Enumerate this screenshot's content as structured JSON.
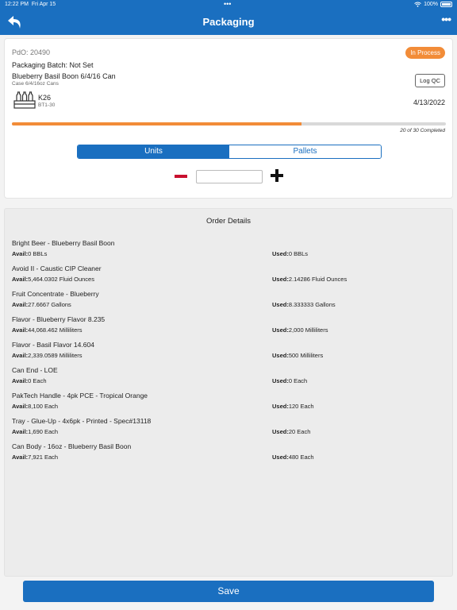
{
  "status_bar": {
    "time": "12:22 PM",
    "date": "Fri Apr 15",
    "battery": "100%",
    "center_dots": "•••"
  },
  "nav": {
    "title": "Packaging",
    "more": "•••"
  },
  "card": {
    "pdo": "PdO: 20490",
    "status": "In Process",
    "batch": "Packaging Batch: Not Set",
    "product": "Blueberry Basil Boon 6/4/16 Can",
    "product_sub": "Case 6/4/16oz Cans",
    "log_qc": "Log QC",
    "code": "K26",
    "code_sub": "BT1-30",
    "date": "4/13/2022",
    "progress_fraction": 0.6667,
    "completed_text": "20 of 30 Completed",
    "segment": {
      "units": "Units",
      "pallets": "Pallets",
      "selected": "Units"
    },
    "quantity_value": ""
  },
  "orders": {
    "title": "Order Details",
    "avail_label": "Avail:",
    "used_label": "Used:",
    "items": [
      {
        "name": "Bright Beer - Blueberry Basil Boon",
        "avail": "0 BBLs",
        "used": "0 BBLs"
      },
      {
        "name": "Avoid II - Caustic CIP Cleaner",
        "avail": "5,464.0302 Fluid Ounces",
        "used": "2.14286 Fluid Ounces"
      },
      {
        "name": "Fruit Concentrate - Blueberry",
        "avail": "27.6667 Gallons",
        "used": "8.333333 Gallons"
      },
      {
        "name": "Flavor - Blueberry Flavor 8.235",
        "avail": "44,068.462 Milliliters",
        "used": "2,000 Milliliters"
      },
      {
        "name": "Flavor - Basil Flavor 14.604",
        "avail": "2,339.0589 Milliliters",
        "used": "500 Milliliters"
      },
      {
        "name": "Can End - LOE",
        "avail": "0 Each",
        "used": "0 Each"
      },
      {
        "name": "PakTech Handle - 4pk PCE - Tropical Orange",
        "avail": "8,100 Each",
        "used": "120 Each"
      },
      {
        "name": "Tray - Glue-Up - 4x6pk - Printed - Spec#13118",
        "avail": "1,690 Each",
        "used": "20 Each"
      },
      {
        "name": "Can Body - 16oz - Blueberry Basil Boon",
        "avail": "7,921 Each",
        "used": "480 Each"
      }
    ]
  },
  "save_label": "Save",
  "colors": {
    "primary": "#1a6fc0",
    "accent": "#f28c38",
    "minus": "#c8102e"
  }
}
